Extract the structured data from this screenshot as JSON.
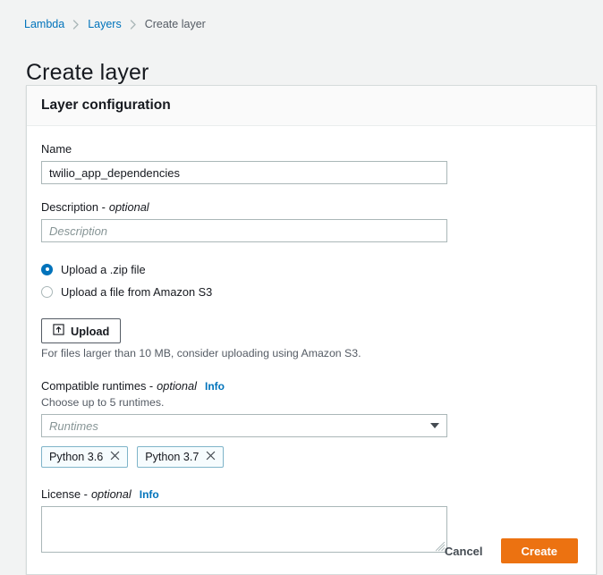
{
  "breadcrumb": {
    "items": [
      {
        "label": "Lambda",
        "current": false
      },
      {
        "label": "Layers",
        "current": false
      },
      {
        "label": "Create layer",
        "current": true
      }
    ]
  },
  "page": {
    "title": "Create layer"
  },
  "card": {
    "header_title": "Layer configuration"
  },
  "form": {
    "name": {
      "label": "Name",
      "value": "twilio_app_dependencies",
      "placeholder": ""
    },
    "description": {
      "label": "Description -",
      "optional": "optional",
      "value": "",
      "placeholder": "Description"
    },
    "upload_source": {
      "options": [
        {
          "label": "Upload a .zip file",
          "selected": true
        },
        {
          "label": "Upload a file from Amazon S3",
          "selected": false
        }
      ]
    },
    "upload": {
      "button_label": "Upload",
      "icon": "upload-icon",
      "helper": "For files larger than 10 MB, consider uploading using Amazon S3."
    },
    "runtimes": {
      "label": "Compatible runtimes -",
      "optional": "optional",
      "info": "Info",
      "sublabel": "Choose up to 5 runtimes.",
      "placeholder": "Runtimes",
      "value": "",
      "tokens": [
        {
          "label": "Python 3.6"
        },
        {
          "label": "Python 3.7"
        }
      ]
    },
    "license": {
      "label": "License -",
      "optional": "optional",
      "info": "Info",
      "value": "",
      "placeholder": ""
    }
  },
  "footer": {
    "cancel_label": "Cancel",
    "create_label": "Create"
  },
  "colors": {
    "accent_orange": "#ec7211",
    "link_blue": "#0073bb",
    "page_background": "#f2f3f3",
    "token_border": "#7fb4c9"
  }
}
